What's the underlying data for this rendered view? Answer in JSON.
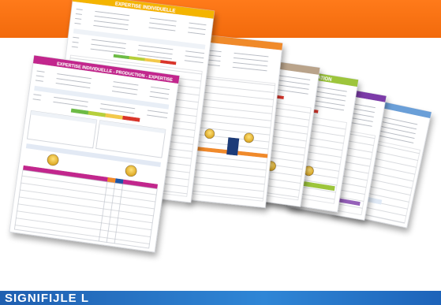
{
  "banner_text": "SIGNIFIJLE L",
  "sheets": [
    {
      "accent": "#6a9fd8",
      "title": ""
    },
    {
      "accent": "#7b3aa8",
      "title": ""
    },
    {
      "accent": "#9dc53a",
      "title": "LOATION"
    },
    {
      "accent": "#b9a38a",
      "title": ""
    },
    {
      "accent": "#f08a2a",
      "title": ""
    },
    {
      "accent": "#f4b400",
      "title": "EXPERTISE INDIVIDUELLE"
    },
    {
      "accent": "#c2288d",
      "title": "EXPERTISE INDIVIDUELLE - PRODUCTION - EXPERTISE"
    }
  ],
  "colors": {
    "orange": "#f26a0c",
    "blue": "#2f86d6",
    "red": "#d9342b",
    "green": "#6dbb45",
    "yellow": "#f2c94c"
  }
}
